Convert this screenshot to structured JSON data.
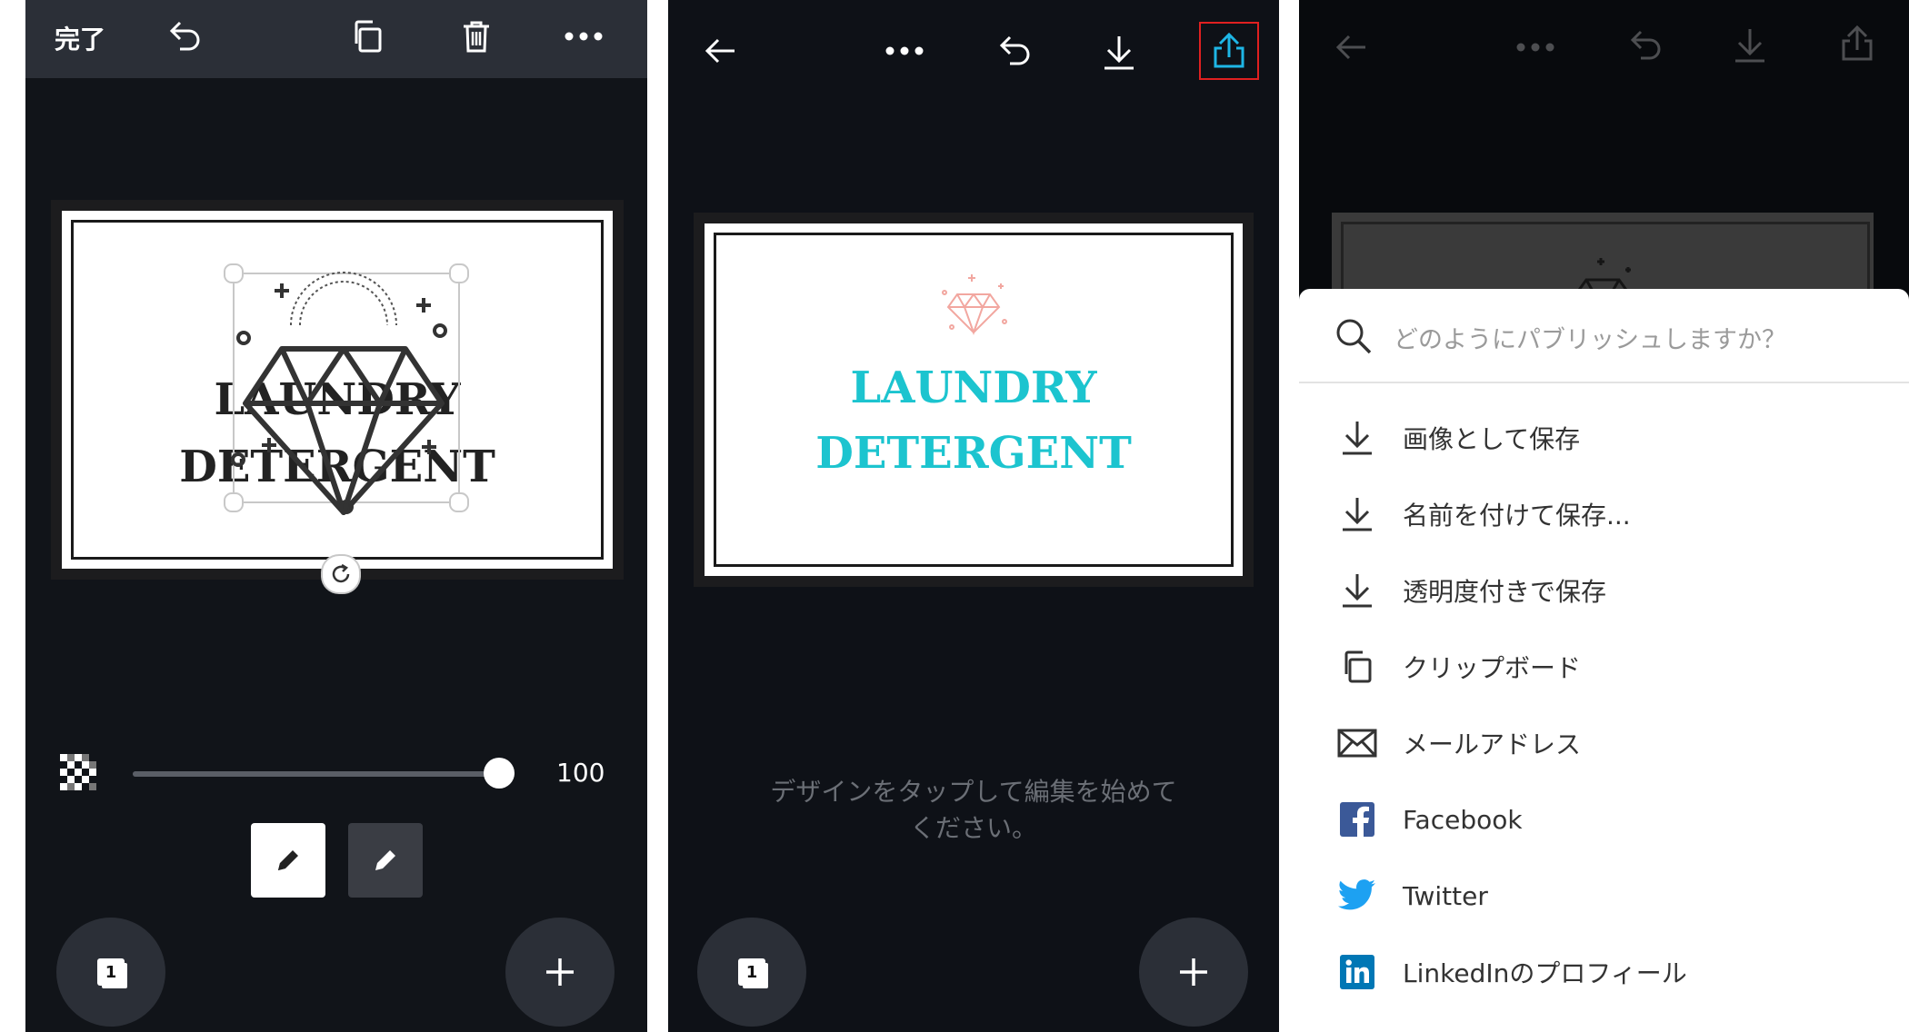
{
  "panel1": {
    "toolbar": {
      "done_label": "完了",
      "undo_icon": "undo-icon",
      "duplicate_icon": "copy-icon",
      "delete_icon": "trash-icon",
      "more_icon": "more-icon"
    },
    "design": {
      "line1": "LAUNDRY",
      "line2": "DETERGENT",
      "text_color": "#222222"
    },
    "transparency": {
      "icon": "transparency-icon",
      "value": 100,
      "value_text": "100"
    },
    "color_buttons": [
      "white-pen-button",
      "dark-pen-button"
    ],
    "page_count": "1",
    "add_icon": "plus-icon"
  },
  "panel2": {
    "toolbar": {
      "back_icon": "back-arrow-icon",
      "more_icon": "more-icon",
      "undo_icon": "undo-icon",
      "download_icon": "download-icon",
      "share_icon": "share-icon",
      "highlight_color": "#e02020"
    },
    "design": {
      "line1": "LAUNDRY",
      "line2": "DETERGENT",
      "text_color": "#1cc4cf",
      "gem_color": "#f2a7a0"
    },
    "hint_line1": "デザインをタップして編集を始めて",
    "hint_line2": "ください。",
    "page_count": "1",
    "add_icon": "plus-icon"
  },
  "panel3": {
    "search": {
      "placeholder": "どのようにパブリッシュしますか？"
    },
    "items": [
      {
        "label": "画像として保存",
        "icon": "download-icon"
      },
      {
        "label": "名前を付けて保存...",
        "icon": "download-icon"
      },
      {
        "label": "透明度付きで保存",
        "icon": "download-icon"
      },
      {
        "label": "クリップボード",
        "icon": "copy-icon"
      },
      {
        "label": "メールアドレス",
        "icon": "mail-icon"
      },
      {
        "label": "Facebook",
        "icon": "facebook-icon",
        "color": "#3b5998"
      },
      {
        "label": "Twitter",
        "icon": "twitter-icon",
        "color": "#1da1f2"
      },
      {
        "label": "LinkedInのプロフィール",
        "icon": "linkedin-icon",
        "color": "#0077b5"
      }
    ]
  }
}
